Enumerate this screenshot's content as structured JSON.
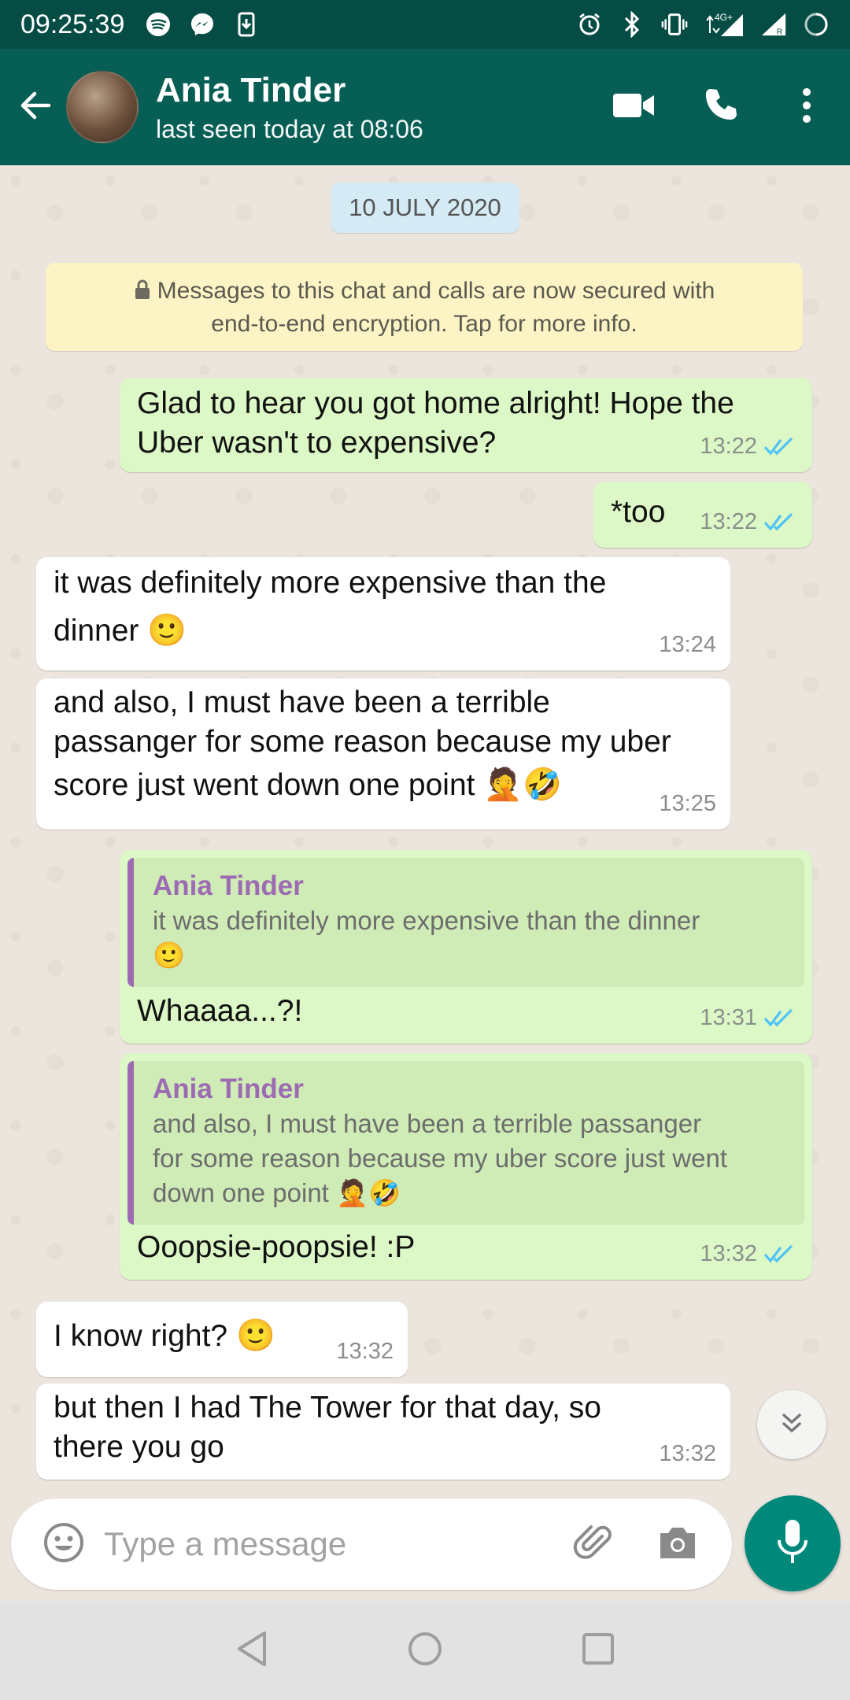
{
  "status_bar": {
    "time": "09:25:39",
    "network_label": "4G⁺",
    "roaming_label": "R"
  },
  "header": {
    "contact_name": "Ania Tinder",
    "last_seen": "last seen today at 08:06",
    "icons": [
      "back-arrow-icon",
      "video-call-icon",
      "voice-call-icon",
      "more-options-icon"
    ]
  },
  "chat": {
    "date_chip": "10 JULY 2020",
    "encryption_notice": {
      "line1": "Messages to this chat and calls are now secured with",
      "line2": "end-to-end encryption. Tap for more info."
    },
    "messages": [
      {
        "direction": "outgoing",
        "line1": "Glad to hear you got home alright! Hope the",
        "line2": "Uber wasn't to expensive?",
        "time": "13:22",
        "status": "read"
      },
      {
        "direction": "outgoing",
        "text": "*too",
        "time": "13:22",
        "status": "read"
      },
      {
        "direction": "incoming",
        "line1": "it was definitely more expensive than the",
        "line2": "dinner",
        "emoji": "🙂",
        "time": "13:24"
      },
      {
        "direction": "incoming",
        "line1": "and also, I must have been a terrible",
        "line2": "passanger for some reason because my uber",
        "line3": "score just went down one point",
        "emoji": "🤦🤣",
        "time": "13:25"
      },
      {
        "direction": "outgoing",
        "quote_author": "Ania Tinder",
        "quote_line1": "it was definitely more expensive than the dinner",
        "quote_emoji": "🙂",
        "text": "Whaaaa...?!",
        "time": "13:31",
        "status": "read"
      },
      {
        "direction": "outgoing",
        "quote_author": "Ania Tinder",
        "quote_line1": "and also, I must have been a terrible passanger",
        "quote_line2": "for some reason because my uber score just went",
        "quote_line3": "down one point",
        "quote_emoji": "🤦🤣",
        "text": "Ooopsie-poopsie! :P",
        "time": "13:32",
        "status": "read"
      },
      {
        "direction": "incoming",
        "text": "I know right?",
        "emoji": "🙂",
        "time": "13:32"
      },
      {
        "direction": "incoming",
        "line1": "but then I had The Tower for that day, so",
        "line2": "there you go",
        "time": "13:32"
      }
    ]
  },
  "composer": {
    "placeholder": "Type a message",
    "value": ""
  },
  "colors": {
    "header": "#075e54",
    "status_bar": "#054d44",
    "outgoing_bubble": "#dcf8c6",
    "incoming_bubble": "#ffffff",
    "read_ticks": "#4fc3f7",
    "mic_button": "#00897b",
    "quote_author": "#9c6bb3"
  }
}
